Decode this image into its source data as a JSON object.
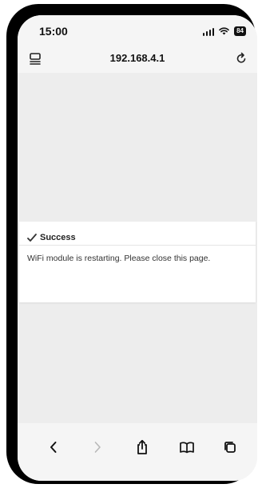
{
  "status_bar": {
    "time": "15:00",
    "battery": "84",
    "icons": [
      "signal-icon",
      "wifi-icon",
      "battery-icon"
    ]
  },
  "browser": {
    "url": "192.168.4.1",
    "icons": [
      "tabs-icon",
      "reload-icon"
    ]
  },
  "message_card": {
    "title": "Success",
    "title_icon": "checkmark-icon",
    "body": "WiFi module is restarting. Please close this page."
  },
  "toolbar": {
    "buttons": [
      "back-icon",
      "forward-icon",
      "share-icon",
      "bookmarks-icon",
      "tabs-overview-icon"
    ],
    "forward_enabled": false
  },
  "colors": {
    "page_background": "#ededed",
    "card_background": "#ffffff",
    "chrome_background": "#f5f5f5",
    "text": "#111111",
    "disabled": "#b8b8b8"
  }
}
